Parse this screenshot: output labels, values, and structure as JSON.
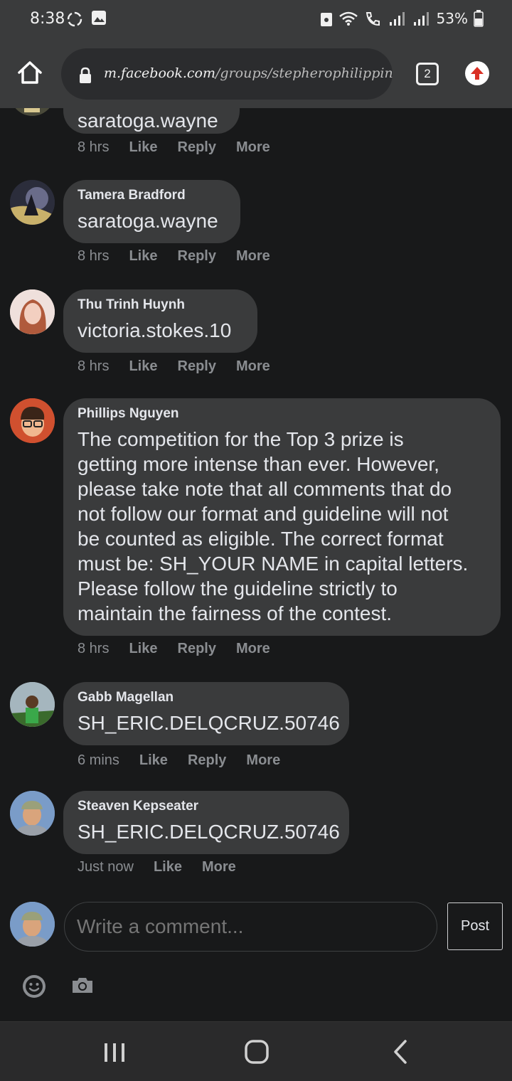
{
  "status_bar": {
    "time": "8:38",
    "battery": "53%"
  },
  "browser": {
    "url_domain": "m.facebook.com",
    "url_path": "/groups/stepherophilippines/permali",
    "tab_count": "2"
  },
  "comments": [
    {
      "author": "",
      "text": "saratoga.wayne",
      "time": "8 hrs",
      "like": "Like",
      "reply": "Reply",
      "more": "More"
    },
    {
      "author": "Tamera Bradford",
      "text": "saratoga.wayne",
      "time": "8 hrs",
      "like": "Like",
      "reply": "Reply",
      "more": "More"
    },
    {
      "author": "Thu Trinh Huynh",
      "text": "victoria.stokes.10",
      "time": "8 hrs",
      "like": "Like",
      "reply": "Reply",
      "more": "More"
    },
    {
      "author": "Phillips Nguyen",
      "text": "The competition for the Top 3 prize is\ngetting more intense than ever. However,\nplease take note that all comments that do\nnot follow our format and guideline will not\nbe counted as eligible. The correct format\nmust be: SH_YOUR NAME in capital letters.\nPlease follow the guideline strictly to\nmaintain the fairness of the contest.",
      "time": "8 hrs",
      "like": "Like",
      "reply": "Reply",
      "more": "More"
    },
    {
      "author": "Gabb Magellan",
      "text": "SH_ERIC.DELQCRUZ.50746",
      "time": "6 mins",
      "like": "Like",
      "reply": "Reply",
      "more": "More"
    },
    {
      "author": "Steaven Kepseater",
      "text": "SH_ERIC.DELQCRUZ.50746",
      "time": "Just now",
      "like": "Like",
      "more": "More"
    }
  ],
  "composer": {
    "placeholder": "Write a comment...",
    "post_label": "Post"
  },
  "colors": {
    "background": "#18191a",
    "bubble": "#3a3b3c",
    "secondary_text": "#8a8d91",
    "update_icon": "#d93025"
  }
}
